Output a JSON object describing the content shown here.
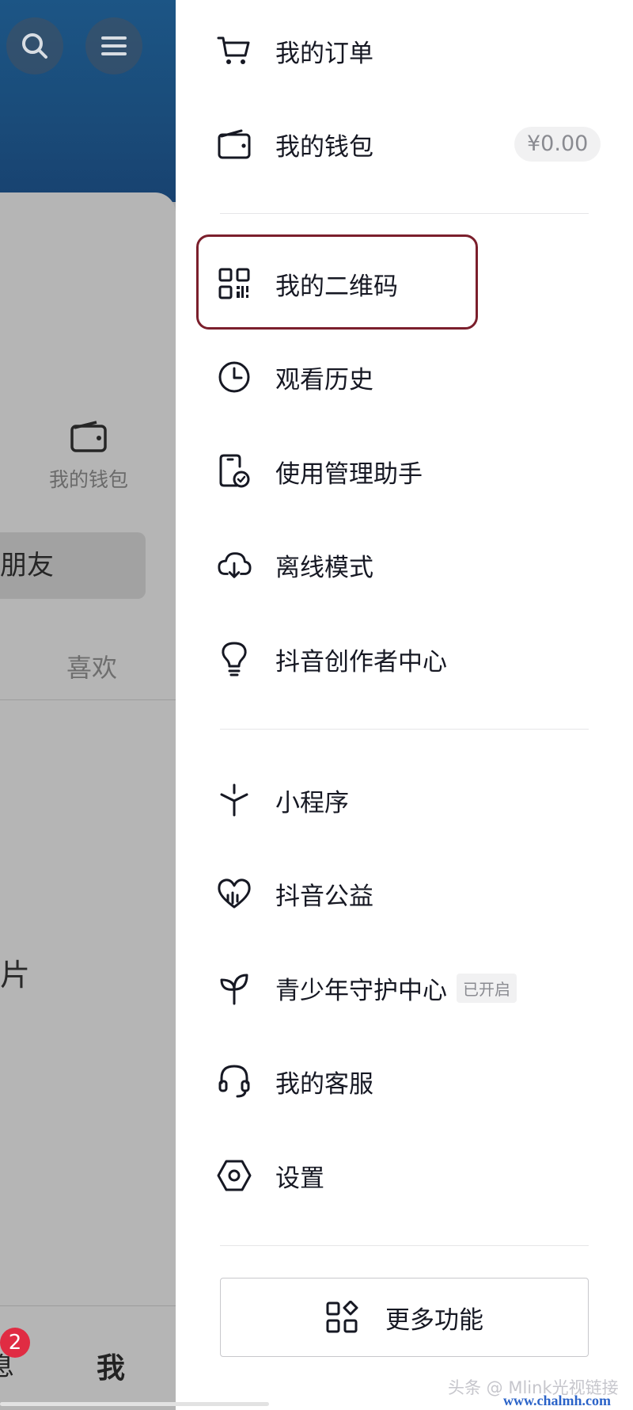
{
  "left_panel": {
    "wallet_label": "我的钱包",
    "friends_label": "朋友",
    "like_tab": "喜欢",
    "photo_text": "片",
    "bottom_badge": "2",
    "bottom_clip": "息",
    "bottom_me": "我"
  },
  "drawer": {
    "orders": "我的订单",
    "wallet": "我的钱包",
    "wallet_balance": "¥0.00",
    "qrcode": "我的二维码",
    "history": "观看历史",
    "assistant": "使用管理助手",
    "offline": "离线模式",
    "creator": "抖音创作者中心",
    "miniapps": "小程序",
    "charity": "抖音公益",
    "youth": "青少年守护中心",
    "youth_badge": "已开启",
    "service": "我的客服",
    "settings": "设置",
    "more": "更多功能"
  },
  "watermark": {
    "text": "头条 @ Mlink光视链接",
    "site": "www.chalmh.com"
  },
  "colors": {
    "header_blue": "#1a4c7a",
    "highlight_border": "#7b1f2c",
    "badge_red": "#e02c43"
  }
}
